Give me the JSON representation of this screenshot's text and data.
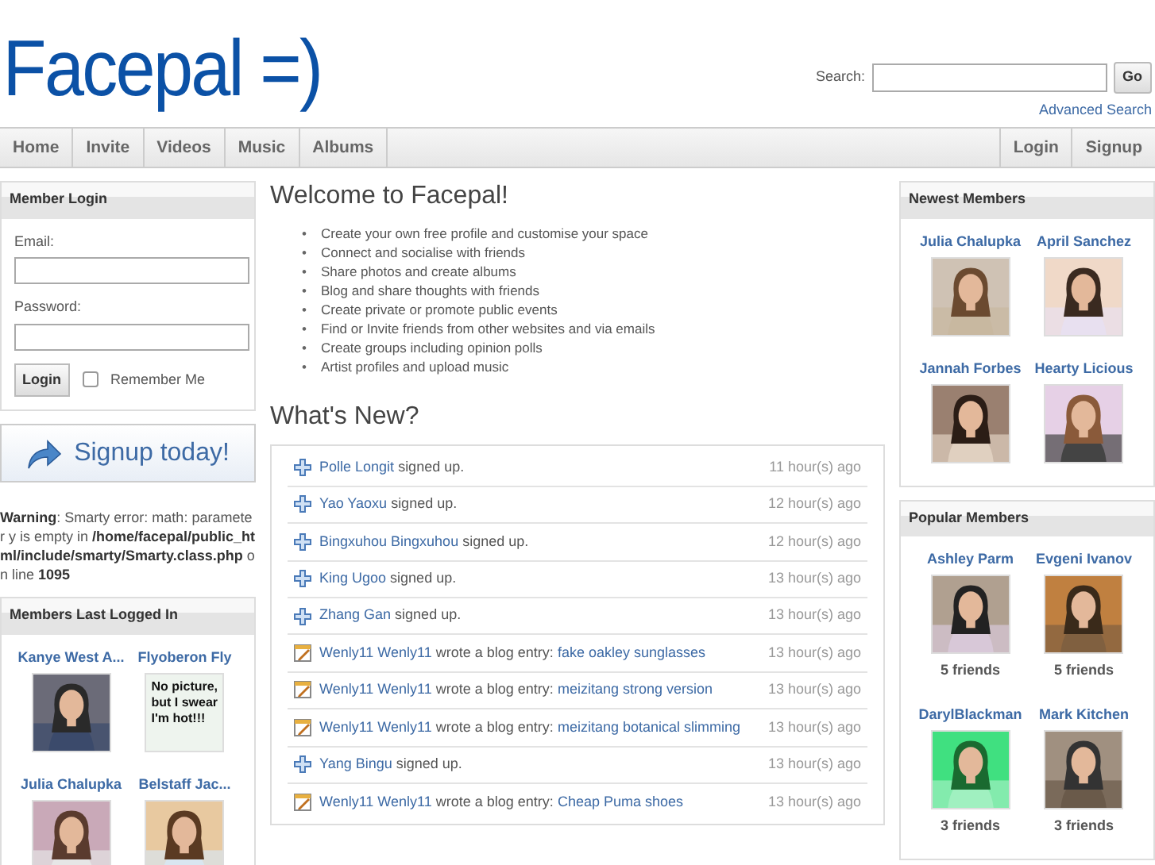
{
  "header": {
    "logo": "Facepal =)",
    "search": {
      "label": "Search:",
      "button": "Go",
      "advanced_link": "Advanced Search"
    }
  },
  "nav": {
    "left": [
      "Home",
      "Invite",
      "Videos",
      "Music",
      "Albums"
    ],
    "right": [
      "Login",
      "Signup"
    ]
  },
  "login": {
    "title": "Member Login",
    "email_label": "Email:",
    "password_label": "Password:",
    "button": "Login",
    "remember": {
      "label": "Remember Me",
      "checked": false
    }
  },
  "signup_banner": "Signup today!",
  "warning": "**Warning**: Smarty error: math: parameter y is empty in **/home/facepal/public_html/include/smarty/Smarty.class.php** on line **1095**",
  "members_last": {
    "title": "Members Last Logged In",
    "members": [
      {
        "name": "Kanye West A...",
        "kind": "picture"
      },
      {
        "name": "Flyoberon Fly",
        "kind": "text_avatar",
        "avatar_text": "No picture, but I swear I'm hot!!!"
      },
      {
        "name": "Julia Chalupka",
        "kind": "picture"
      },
      {
        "name": "Belstaff Jac...",
        "kind": "picture"
      }
    ]
  },
  "welcome": {
    "title": "Welcome to Facepal!",
    "bullet": "•",
    "features": [
      "Create your own free profile and customise your space",
      "Connect and socialise with friends",
      "Share photos and create albums",
      "Blog and share thoughts with friends",
      "Create private or promote public events",
      "Find or Invite friends from other websites and via emails",
      "Create groups including opinion polls",
      "Artist profiles and upload music"
    ]
  },
  "whats_new": {
    "title": "What's New?",
    "items": [
      {
        "kind": "signup",
        "user": "Polle Longit",
        "action": "signed up.",
        "time": "11 hour(s) ago"
      },
      {
        "kind": "signup",
        "user": "Yao Yaoxu",
        "action": "signed up.",
        "time": "12 hour(s) ago"
      },
      {
        "kind": "signup",
        "user": "Bingxuhou Bingxuhou",
        "action": "signed up.",
        "time": "12 hour(s) ago"
      },
      {
        "kind": "signup",
        "user": "King Ugoo",
        "action": "signed up.",
        "time": "13 hour(s) ago"
      },
      {
        "kind": "signup",
        "user": "Zhang Gan",
        "action": "signed up.",
        "time": "13 hour(s) ago"
      },
      {
        "kind": "blog",
        "user": "Wenly11 Wenly11",
        "action": "wrote a blog entry:",
        "link": "fake oakley sunglasses",
        "time": "13 hour(s) ago"
      },
      {
        "kind": "blog",
        "user": "Wenly11 Wenly11",
        "action": "wrote a blog entry:",
        "link": "meizitang strong version",
        "time": "13 hour(s) ago"
      },
      {
        "kind": "blog",
        "user": "Wenly11 Wenly11",
        "action": "wrote a blog entry:",
        "link": "meizitang botanical slimming",
        "time": "13 hour(s) ago"
      },
      {
        "kind": "signup",
        "user": "Yang Bingu",
        "action": "signed up.",
        "time": "13 hour(s) ago"
      },
      {
        "kind": "blog",
        "user": "Wenly11 Wenly11",
        "action": "wrote a blog entry:",
        "link": "Cheap Puma shoes",
        "time": "13 hour(s) ago"
      }
    ]
  },
  "newest_members": {
    "title": "Newest Members",
    "members": [
      {
        "name": "Julia Chalupka",
        "kind": "picture"
      },
      {
        "name": "April Sanchez",
        "kind": "picture"
      },
      {
        "name": "Jannah Forbes",
        "kind": "picture"
      },
      {
        "name": "Hearty Licious",
        "kind": "picture"
      }
    ]
  },
  "popular_members": {
    "title": "Popular Members",
    "members": [
      {
        "name": "Ashley Parm",
        "kind": "picture",
        "friends": "5 friends"
      },
      {
        "name": "Evgeni Ivanov",
        "kind": "picture",
        "friends": "5 friends"
      },
      {
        "name": "DarylBlackman",
        "kind": "picture",
        "friends": "3 friends"
      },
      {
        "name": "Mark Kitchen",
        "kind": "picture",
        "friends": "3 friends"
      }
    ]
  }
}
